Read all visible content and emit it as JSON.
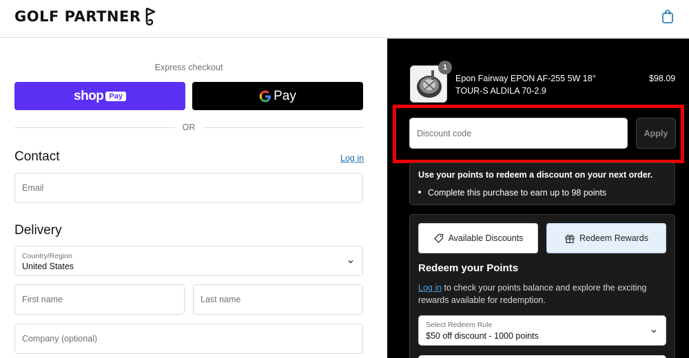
{
  "header": {
    "brand": "GOLF PARTNER"
  },
  "express": {
    "label": "Express checkout",
    "shop_word": "shop",
    "shop_badge": "Pay",
    "gpay_word": "Pay",
    "or": "OR"
  },
  "contact": {
    "title": "Contact",
    "login": "Log in",
    "email_placeholder": "Email"
  },
  "delivery": {
    "title": "Delivery",
    "country_label": "Country/Region",
    "country_value": "United States",
    "first_name": "First name",
    "last_name": "Last name",
    "company": "Company (optional)"
  },
  "order": {
    "quantity": "1",
    "product_name": "Epon Fairway EPON AF-255 5W 18° TOUR-S ALDILA 70-2.9",
    "price": "$98.09",
    "discount_placeholder": "Discount code",
    "apply": "Apply"
  },
  "points": {
    "title": "Use your points to redeem a discount on your next order.",
    "bullet": "Complete this purchase to earn up to 98 points"
  },
  "rewards": {
    "tab_available": "Available Discounts",
    "tab_redeem": "Redeem Rewards",
    "title": "Redeem your Points",
    "login_link": "Log in",
    "desc": " to check your points balance and explore the exciting rewards available for redemption.",
    "rule_label": "Select Redeem Rule",
    "rule_value": "$50 off discount - 1000 points"
  },
  "colors": {
    "shop_pay": "#5a31f4",
    "link": "#1773b0",
    "highlight": "#ee0000",
    "panel_bg": "#000000"
  }
}
